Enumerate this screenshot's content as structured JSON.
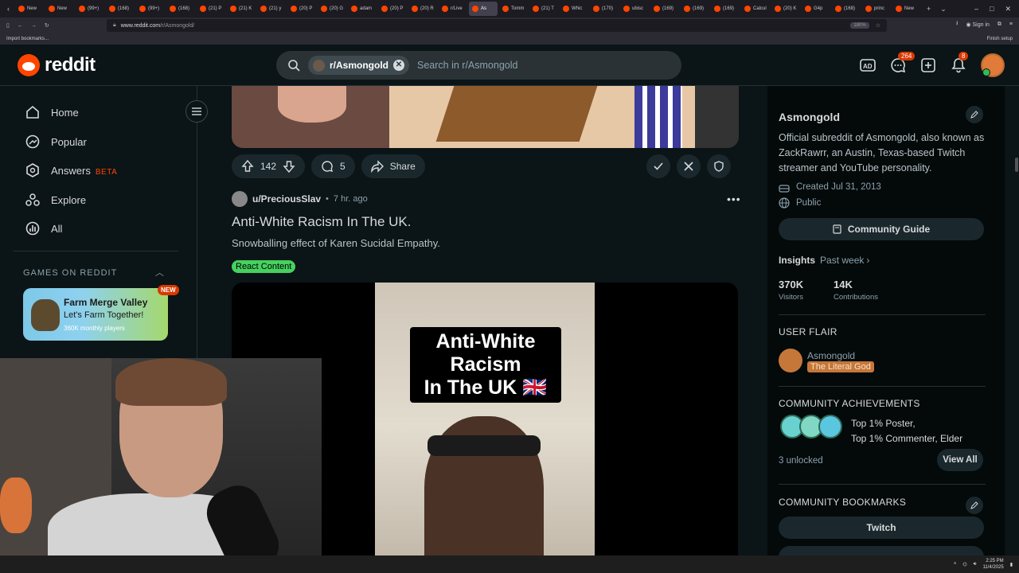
{
  "browser": {
    "tabs": [
      "New",
      "New",
      "(99+)",
      "(168)",
      "(99+)",
      "(168)",
      "(21) P",
      "(21) K",
      "(21) y",
      "(20) P",
      "(20) G",
      "adam",
      "(20) P",
      "(20) R",
      "r/Live",
      "As",
      "Tomm",
      "(21) T",
      "Whic",
      "(170)",
      "ubisc",
      "(169)",
      "(169)",
      "(169)",
      "Calcul",
      "(20) K",
      "G4p",
      "(168)",
      "princ",
      "New"
    ],
    "url_host": "www.reddit.com",
    "url_path": "/r/Asmongold/",
    "zoom": "180%",
    "sign_in": "Sign in",
    "import_bookmarks": "Import bookmarks...",
    "finish_setup": "Finish setup"
  },
  "header": {
    "logo_text": "reddit",
    "search_chip": "r/Asmongold",
    "search_placeholder": "Search in r/Asmongold",
    "chat_badge": "264",
    "notif_badge": "8"
  },
  "leftnav": {
    "items": [
      {
        "label": "Home",
        "icon": "home-icon"
      },
      {
        "label": "Popular",
        "icon": "popular-icon"
      },
      {
        "label": "Answers",
        "icon": "answers-icon",
        "badge": "BETA"
      },
      {
        "label": "Explore",
        "icon": "explore-icon"
      },
      {
        "label": "All",
        "icon": "all-icon"
      }
    ],
    "games_heading": "GAMES ON REDDIT",
    "game": {
      "title": "Farm Merge Valley",
      "subtitle": "Let's Farm Together!",
      "players": "360K monthly players",
      "badge": "NEW"
    }
  },
  "prev_post": {
    "votes": "142",
    "comments": "5",
    "share": "Share"
  },
  "post": {
    "author": "u/PreciousSlav",
    "time": "7 hr. ago",
    "title": "Anti-White Racism In The UK.",
    "body": "Snowballing effect of Karen Sucidal Empathy.",
    "flair": "React Content",
    "media_caption_line1": "Anti-White Racism",
    "media_caption_line2": "In The UK 🇬🇧"
  },
  "sidebar": {
    "name": "Asmongold",
    "description": "Official subreddit of Asmongold, also known as ZackRawrr, an Austin, Texas-based Twitch streamer and YouTube personality.",
    "created": "Created Jul 31, 2013",
    "visibility": "Public",
    "guide_button": "Community Guide",
    "insights_label": "Insights",
    "insights_period": "Past week",
    "visitors_value": "370K",
    "visitors_label": "Visitors",
    "contrib_value": "14K",
    "contrib_label": "Contributions",
    "user_flair_heading": "USER FLAIR",
    "flair_user": "Asmongold",
    "flair_tag": "The Literal God",
    "achievements_heading": "COMMUNITY ACHIEVEMENTS",
    "achievement_line1": "Top 1% Poster,",
    "achievement_line2": "Top 1% Commenter, Elder",
    "unlocked": "3 unlocked",
    "view_all": "View All",
    "bookmarks_heading": "COMMUNITY BOOKMARKS",
    "bookmark1": "Twitch"
  },
  "taskbar": {
    "time": "2:25 PM",
    "date": "11/4/2025"
  }
}
